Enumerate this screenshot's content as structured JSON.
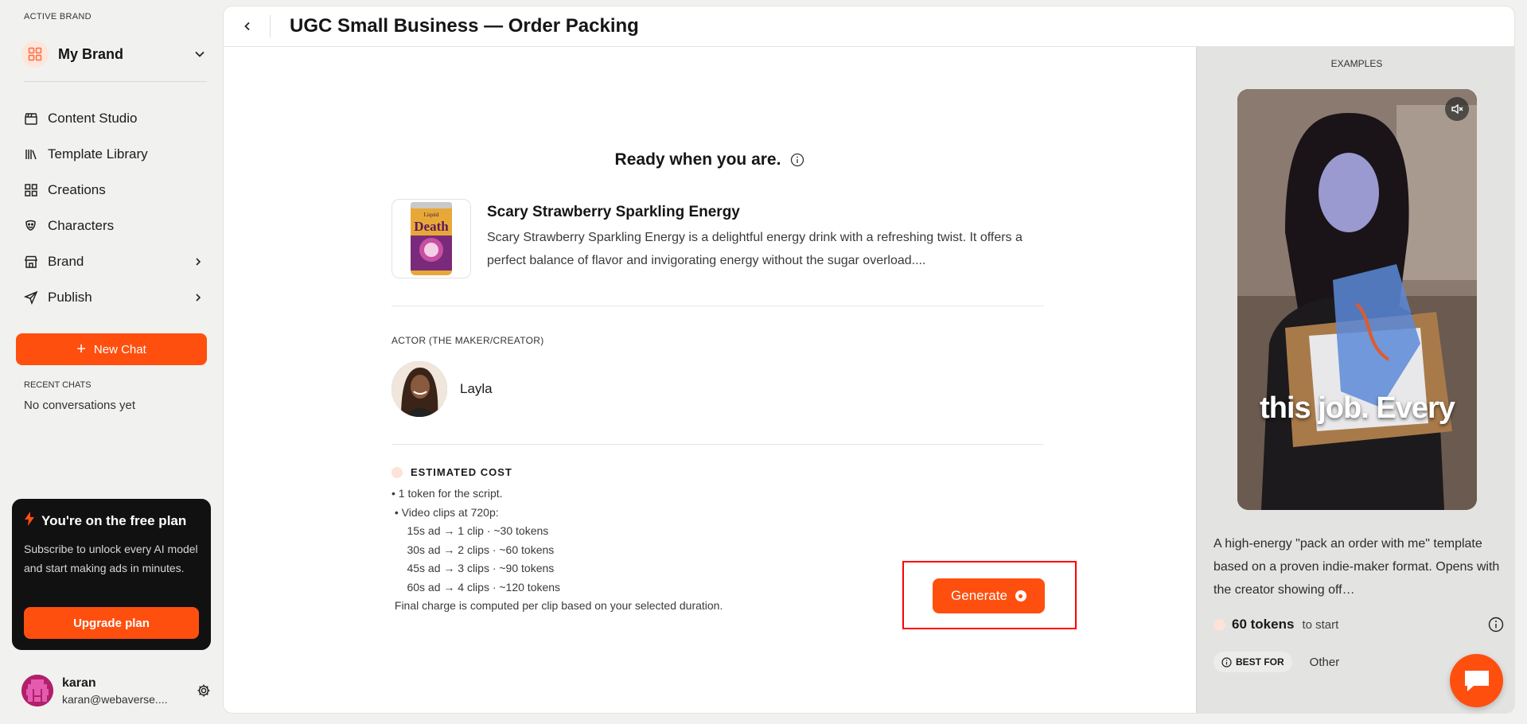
{
  "sidebar": {
    "active_brand_label": "ACTIVE BRAND",
    "brand_name": "My Brand",
    "nav": [
      {
        "label": "Content Studio",
        "icon": "clapperboard-icon"
      },
      {
        "label": "Template Library",
        "icon": "library-icon"
      },
      {
        "label": "Creations",
        "icon": "grid-icon"
      },
      {
        "label": "Characters",
        "icon": "drama-masks-icon"
      },
      {
        "label": "Brand",
        "icon": "store-icon"
      },
      {
        "label": "Publish",
        "icon": "send-icon"
      }
    ],
    "new_chat_label": "New Chat",
    "recent_chats_label": "RECENT CHATS",
    "recent_chats_empty": "No conversations yet",
    "plan": {
      "title": "You're on the free plan",
      "text": "Subscribe to unlock every AI model and start making ads in minutes.",
      "button": "Upgrade plan"
    },
    "user": {
      "name": "karan",
      "email": "karan@webaverse...."
    }
  },
  "header": {
    "title": "UGC Small Business — Order Packing"
  },
  "main": {
    "ready_text": "Ready when you are.",
    "product": {
      "name": "Scary Strawberry Sparkling Energy",
      "description": "Scary Strawberry Sparkling Energy is a delightful energy drink with a refreshing twist. It offers a perfect balance of flavor and invigorating energy without the sugar overload....",
      "can_label": "Death",
      "can_top": "Liquid"
    },
    "actor_label": "ACTOR (THE MAKER/CREATOR)",
    "actor_name": "Layla",
    "cost": {
      "heading": "ESTIMATED COST",
      "lines": [
        "• 1 token for the script.",
        " • Video clips at 720p:",
        "     15s ad → 1 clip · ~30 tokens",
        "     30s ad → 2 clips · ~60 tokens",
        "     45s ad → 3 clips · ~90 tokens",
        "     60s ad → 4 clips · ~120 tokens",
        " Final charge is computed per clip based on your selected duration."
      ]
    },
    "generate_label": "Generate"
  },
  "examples": {
    "label": "EXAMPLES",
    "caption": "this job. Every",
    "description": "A high-energy \"pack an order with me\" template based on a proven indie-maker format. Opens with the creator showing off…",
    "tokens": "60 tokens",
    "tokens_suffix": "to start",
    "best_for_label": "BEST FOR",
    "best_for_value": "Other"
  },
  "colors": {
    "accent": "#ff4f0f",
    "highlight": "#ff0000"
  }
}
